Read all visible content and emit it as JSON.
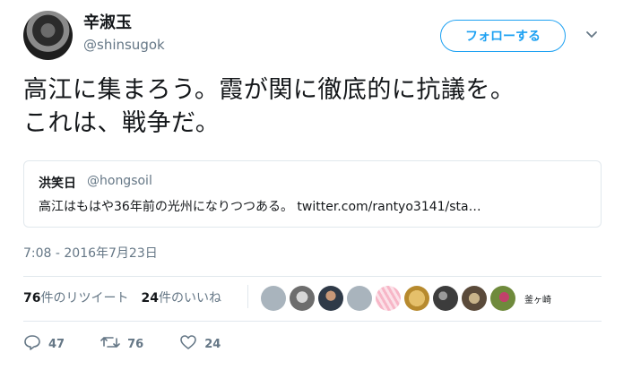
{
  "author": {
    "display_name": "辛淑玉",
    "handle": "@shinsugok"
  },
  "follow_button_label": "フォローする",
  "tweet": {
    "text_line1": "高江に集まろう。霞が関に徹底的に抗議を。",
    "text_line2": "これは、戦争だ。",
    "timestamp": "7:08 - 2016年7月23日"
  },
  "quoted_tweet": {
    "name": "洪笑日",
    "handle": "@hongsoil",
    "text": "高江はもはや36年前の光州になりつつある。 twitter.com/rantyo3141/sta…"
  },
  "stats": {
    "retweets_count": "76",
    "retweets_label": "件のリツイート",
    "likes_count": "24",
    "likes_label": "件のいいね"
  },
  "likers": {
    "last_label": "釜ヶ崎"
  },
  "actions": {
    "reply_count": "47",
    "retweet_count": "76",
    "like_count": "24"
  },
  "colors": {
    "accent": "#1da1f2",
    "muted": "#657786",
    "border": "#e1e8ed"
  }
}
